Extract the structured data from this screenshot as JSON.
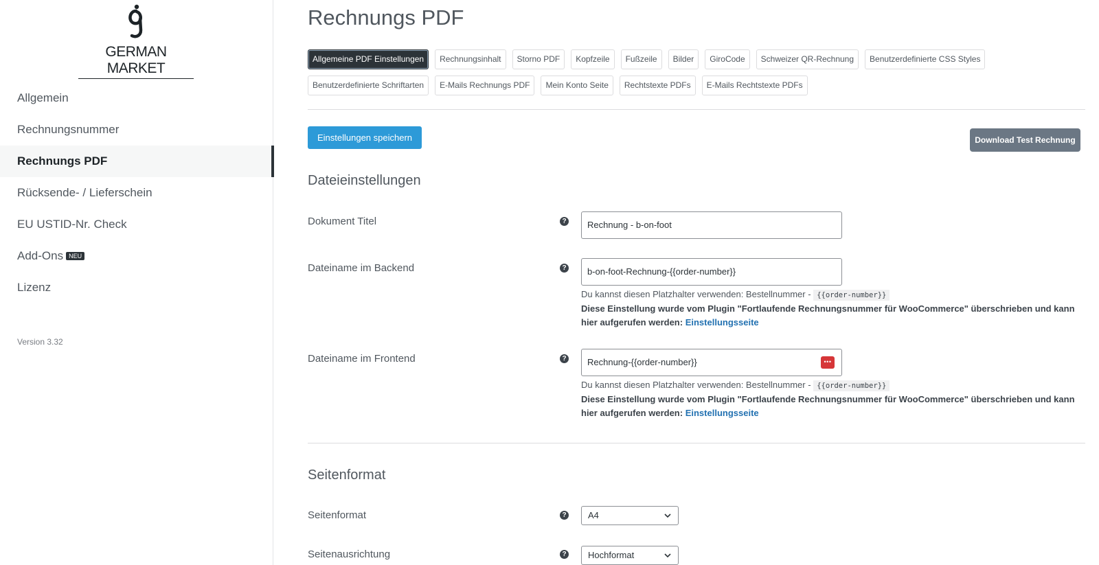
{
  "sidebar": {
    "logo_text": "GERMAN MARKET",
    "items": [
      {
        "label": "Allgemein"
      },
      {
        "label": "Rechnungsnummer"
      },
      {
        "label": "Rechnungs PDF"
      },
      {
        "label": "Rücksende- / Lieferschein"
      },
      {
        "label": "EU USTID-Nr. Check"
      },
      {
        "label": "Add-Ons",
        "badge": "NEU"
      },
      {
        "label": "Lizenz"
      }
    ],
    "active_index": 2,
    "version": "Version 3.32"
  },
  "main": {
    "title": "Rechnungs PDF",
    "tabs": [
      {
        "label": "Allgemeine PDF Einstellungen",
        "active": true
      },
      {
        "label": "Rechnungsinhalt"
      },
      {
        "label": "Storno PDF"
      },
      {
        "label": "Kopfzeile"
      },
      {
        "label": "Fußzeile"
      },
      {
        "label": "Bilder"
      },
      {
        "label": "GiroCode"
      },
      {
        "label": "Schweizer QR-Rechnung"
      },
      {
        "label": "Benutzerdefinierte CSS Styles"
      },
      {
        "label": "Benutzerdefinierte Schriftarten"
      },
      {
        "label": "E-Mails Rechnungs PDF"
      },
      {
        "label": "Mein Konto Seite"
      },
      {
        "label": "Rechtstexte PDFs"
      },
      {
        "label": "E-Mails Rechtstexte PDFs"
      }
    ],
    "save_label": "Einstellungen speichern",
    "download_label": "Download Test Rechnung",
    "help_glyph": "?",
    "file_section": {
      "title": "Dateieinstellungen",
      "fields": [
        {
          "label": "Dokument Titel",
          "value": "Rechnung - b-on-foot"
        },
        {
          "label": "Dateiname im Backend",
          "value": "b-on-foot-Rechnung-{{order-number}}",
          "placeholder_hint": "Du kannst diesen Platzhalter verwenden: Bestellnummer -",
          "placeholder_code": "{{order-number}}",
          "override_note": "Diese Einstellung wurde vom Plugin \"Fortlaufende Rechnungsnummer für WooCommerce\" überschrieben und kann hier aufgerufen werden:",
          "override_link": "Einstellungsseite"
        },
        {
          "label": "Dateiname im Frontend",
          "value": "Rechnung-{{order-number}}",
          "placeholder_hint": "Du kannst diesen Platzhalter verwenden: Bestellnummer -",
          "placeholder_code": "{{order-number}}",
          "override_note": "Diese Einstellung wurde vom Plugin \"Fortlaufende Rechnungsnummer für WooCommerce\" überschrieben und kann hier aufgerufen werden:",
          "override_link": "Einstellungsseite"
        }
      ]
    },
    "page_section": {
      "title": "Seitenformat",
      "fields": [
        {
          "label": "Seitenformat",
          "value": "A4"
        },
        {
          "label": "Seitenausrichtung",
          "value": "Hochformat"
        }
      ]
    }
  },
  "colors": {
    "primary_button": "#2d9ad8",
    "secondary_button": "#6b7784",
    "active_tab": "#2c3338",
    "link": "#2271b1",
    "password_icon": "#d63638"
  },
  "icons": {
    "help": "help-icon",
    "password_manager": "password-manager-icon",
    "select_chevron": "chevron-down-icon"
  }
}
